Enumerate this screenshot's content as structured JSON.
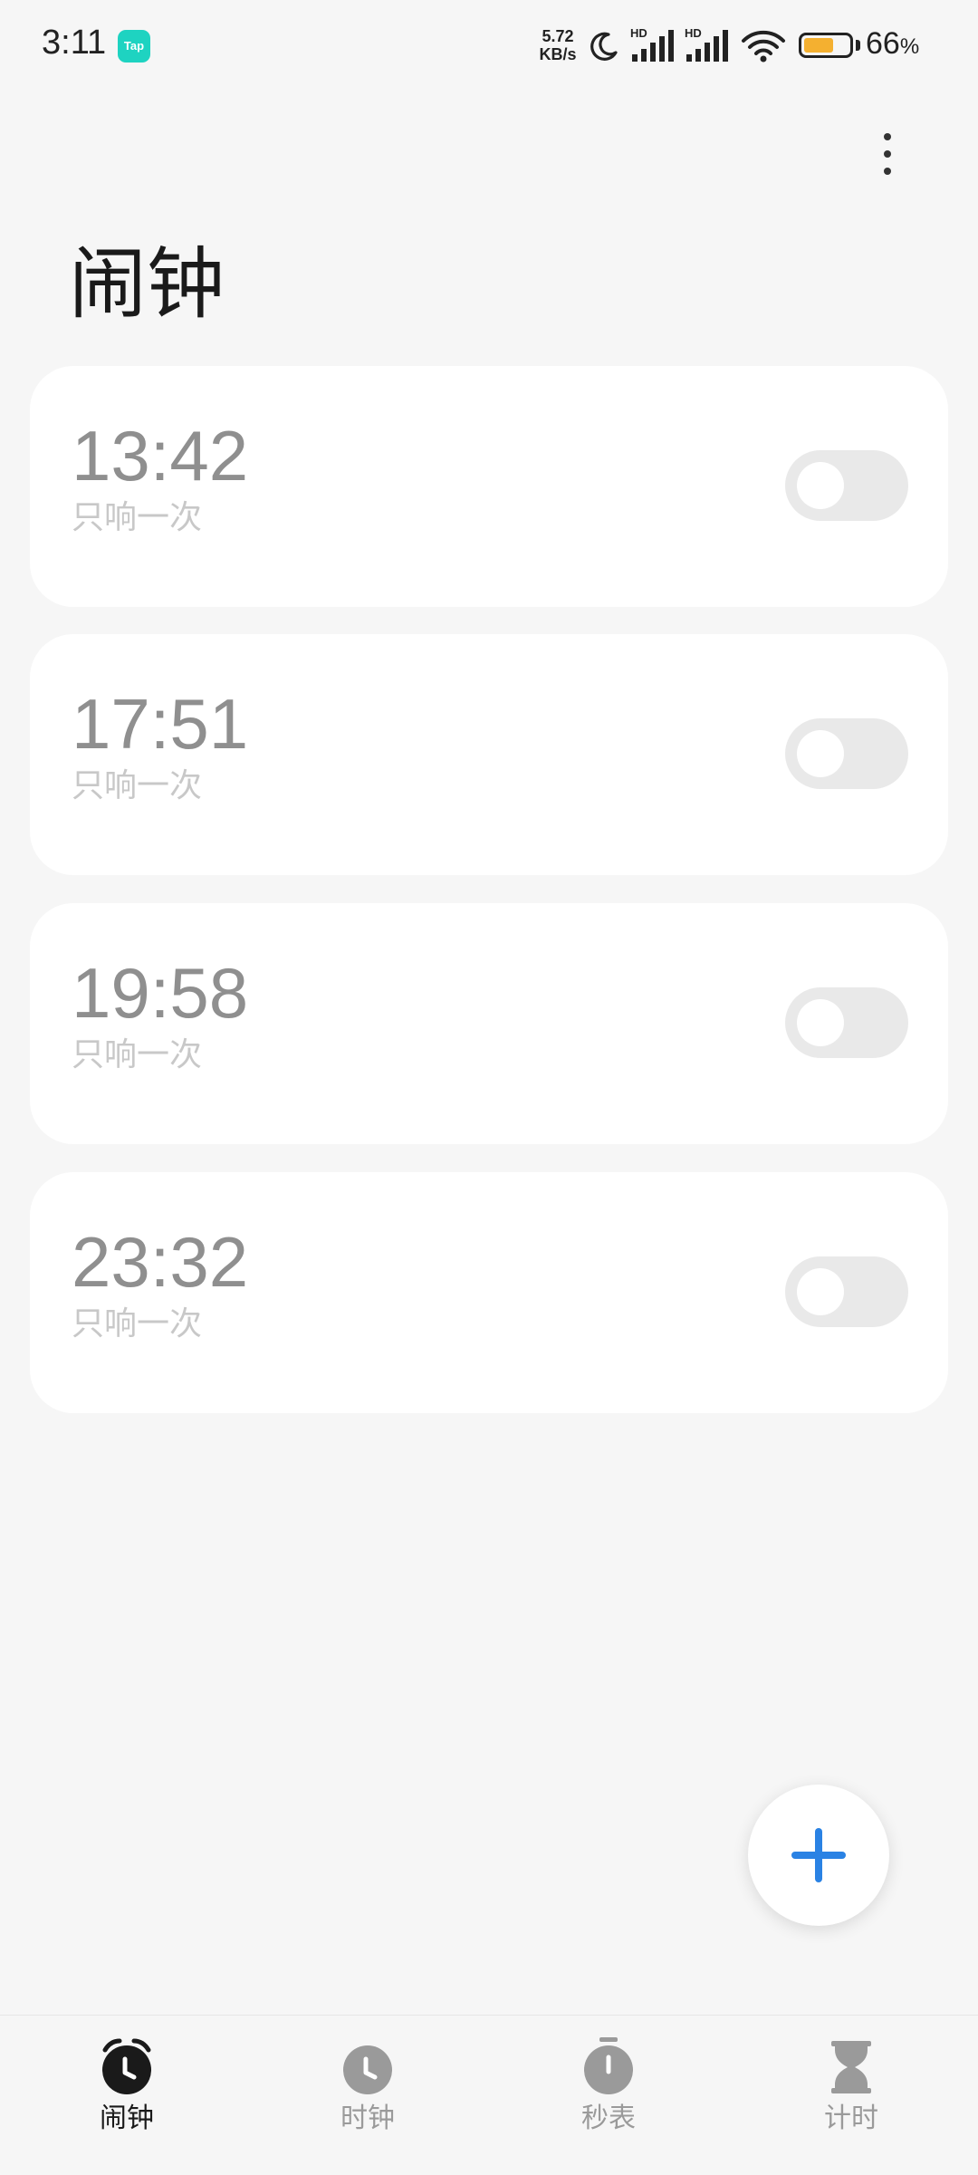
{
  "status_bar": {
    "time": "3:11",
    "app_badge": "Tap",
    "net_speed_value": "5.72",
    "net_speed_unit": "KB/s",
    "signal_1_label": "HD",
    "signal_2_label": "HD",
    "battery_percent": 66,
    "battery_text": "66",
    "battery_unit": "%",
    "battery_color": "#f4b030",
    "icons": [
      "moon-icon",
      "signal-icon",
      "signal-icon",
      "wifi-icon",
      "battery-icon"
    ]
  },
  "header": {
    "title": "闹钟",
    "more_icon": "more-vertical-icon"
  },
  "alarms": [
    {
      "time": "13:42",
      "repeat": "只响一次",
      "enabled": false
    },
    {
      "time": "17:51",
      "repeat": "只响一次",
      "enabled": false
    },
    {
      "time": "19:58",
      "repeat": "只响一次",
      "enabled": false
    },
    {
      "time": "23:32",
      "repeat": "只响一次",
      "enabled": false
    }
  ],
  "fab": {
    "icon": "plus-icon",
    "color": "#2a82e4"
  },
  "bottom_nav": {
    "items": [
      {
        "label": "闹钟",
        "icon": "alarm-clock-icon",
        "active": true
      },
      {
        "label": "时钟",
        "icon": "clock-icon",
        "active": false
      },
      {
        "label": "秒表",
        "icon": "stopwatch-icon",
        "active": false
      },
      {
        "label": "计时",
        "icon": "hourglass-icon",
        "active": false
      }
    ]
  }
}
